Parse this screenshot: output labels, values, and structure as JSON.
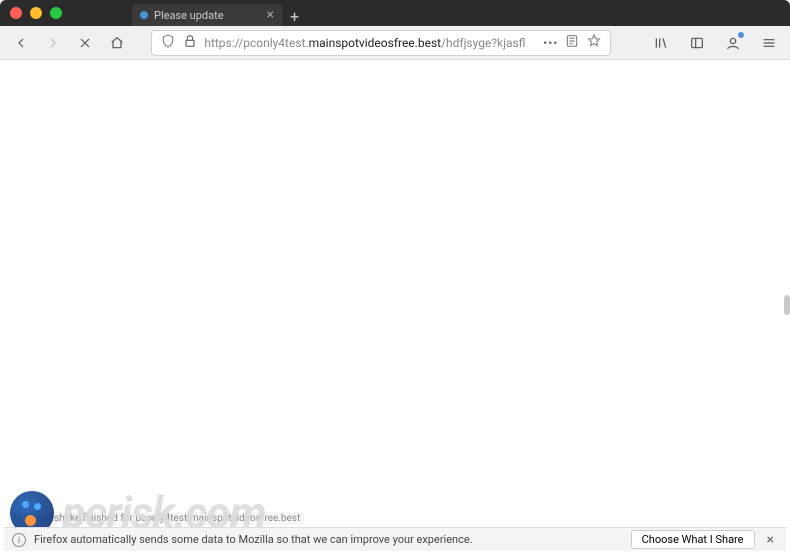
{
  "window": {
    "tab_title": "Please update",
    "new_tab_glyph": "+"
  },
  "toolbar": {
    "url_prefix": "https://pconly4test.",
    "url_domain": "mainspotvideosfree.best",
    "url_suffix": "/hdfjsyge?kjasfl",
    "more_glyph": "•••"
  },
  "status": {
    "text": "TLS handshake finished for pconly4test.mainspotvideosfree.best"
  },
  "notification": {
    "icon_glyph": "i",
    "text": "Firefox automatically sends some data to Mozilla so that we can improve your experience.",
    "button": "Choose What I Share",
    "close_glyph": "×"
  },
  "watermark": {
    "text": "pcrisk.com"
  }
}
